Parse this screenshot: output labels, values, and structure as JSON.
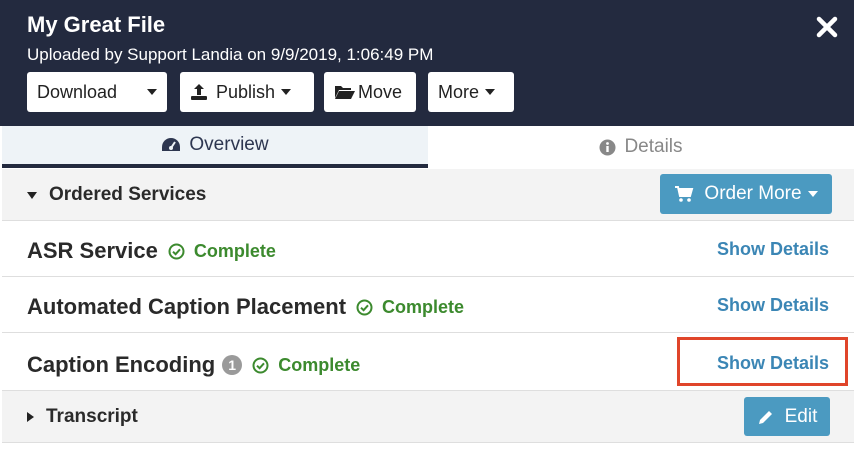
{
  "header": {
    "title": "My Great File",
    "subtitle": "Uploaded by Support Landia on 9/9/2019, 1:06:49 PM",
    "close_icon": "close-icon",
    "bg_color": "#232a3f"
  },
  "toolbar": {
    "download_label": "Download",
    "publish_label": "Publish",
    "move_label": "Move",
    "more_label": "More"
  },
  "tabs": [
    {
      "label": "Overview",
      "icon": "gauge-icon",
      "active": true
    },
    {
      "label": "Details",
      "icon": "info-icon",
      "active": false
    }
  ],
  "ordered_services": {
    "title": "Ordered Services",
    "order_more_label": "Order More",
    "items": [
      {
        "name": "ASR Service",
        "status": "Complete",
        "link": "Show Details"
      },
      {
        "name": "Automated Caption Placement",
        "status": "Complete",
        "link": "Show Details"
      },
      {
        "name": "Caption Encoding",
        "badge": "1",
        "status": "Complete",
        "link": "Show Details"
      }
    ]
  },
  "transcript": {
    "title": "Transcript",
    "edit_label": "Edit"
  },
  "colors": {
    "accent": "#4b9ac1",
    "status_complete": "#3c8a2e",
    "link": "#3b86b5",
    "highlight": "#e0452a"
  }
}
